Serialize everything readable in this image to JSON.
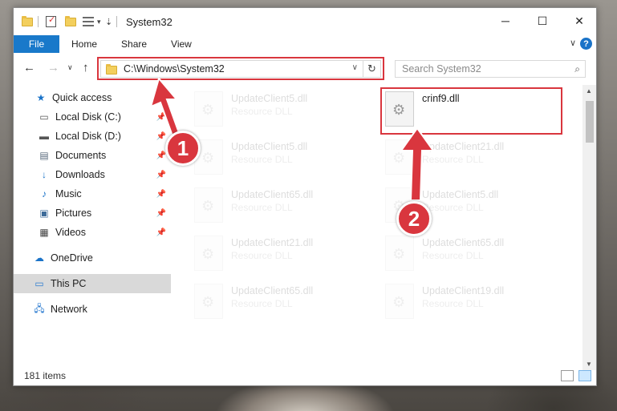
{
  "window": {
    "title": "System32"
  },
  "ribbon": {
    "tabs": [
      "File",
      "Home",
      "Share",
      "View"
    ]
  },
  "address": {
    "path": "C:\\Windows\\System32"
  },
  "search": {
    "placeholder": "Search System32"
  },
  "nav": {
    "quick_access": "Quick access",
    "items": [
      {
        "label": "Local Disk (C:)",
        "icon": "drive-icon",
        "pinned": true
      },
      {
        "label": "Local Disk (D:)",
        "icon": "drive-icon",
        "pinned": true
      },
      {
        "label": "Documents",
        "icon": "documents-icon",
        "pinned": true
      },
      {
        "label": "Downloads",
        "icon": "downloads-icon",
        "pinned": true
      },
      {
        "label": "Music",
        "icon": "music-icon",
        "pinned": true
      },
      {
        "label": "Pictures",
        "icon": "pictures-icon",
        "pinned": true
      },
      {
        "label": "Videos",
        "icon": "videos-icon",
        "pinned": true
      }
    ],
    "onedrive": "OneDrive",
    "this_pc": "This PC",
    "network": "Network"
  },
  "files": [
    {
      "name": "UpdateClient5.dll",
      "type": "Resource DLL"
    },
    {
      "name": "crinf9.dll",
      "type": ""
    },
    {
      "name": "UpdateClient5.dll",
      "type": "Resource DLL"
    },
    {
      "name": "UpdateClient21.dll",
      "type": "Resource DLL"
    },
    {
      "name": "UpdateClient65.dll",
      "type": "Resource DLL"
    },
    {
      "name": "UpdateClient5.dll",
      "type": "Resource DLL"
    },
    {
      "name": "UpdateClient21.dll",
      "type": "Resource DLL"
    },
    {
      "name": "UpdateClient65.dll",
      "type": "Resource DLL"
    },
    {
      "name": "UpdateClient65.dll",
      "type": "Resource DLL"
    },
    {
      "name": "UpdateClient19.dll",
      "type": "Resource DLL"
    }
  ],
  "status": {
    "items": "181 items"
  },
  "annotations": {
    "step1": "1",
    "step2": "2"
  },
  "colors": {
    "accent": "#1979ca",
    "highlight": "#d9363e",
    "selected": "#d9d9d9"
  }
}
